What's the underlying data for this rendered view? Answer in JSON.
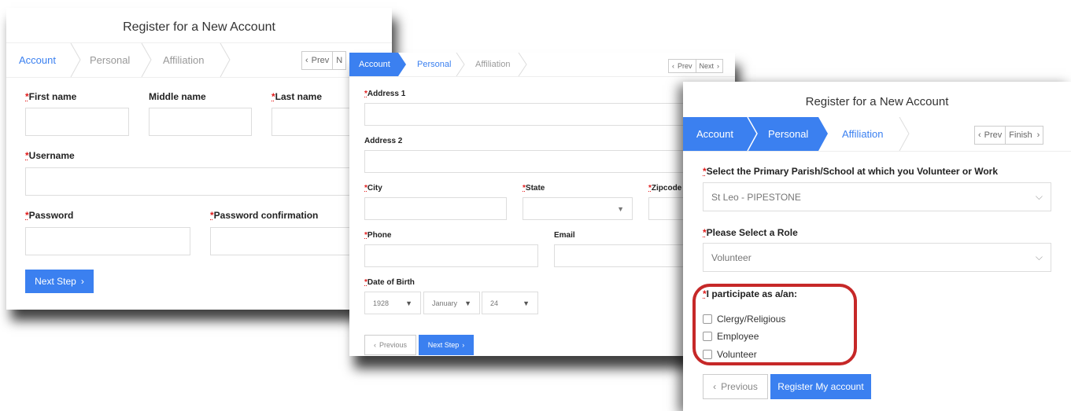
{
  "panel1": {
    "title": "Register for a New Account",
    "steps": [
      "Account",
      "Personal",
      "Affiliation"
    ],
    "nav": {
      "prev": "Prev",
      "next": "N"
    },
    "labels": {
      "first_name": "First name",
      "middle_name": "Middle name",
      "last_name": "Last name",
      "username": "Username",
      "password": "Password",
      "password_confirmation": "Password confirmation"
    },
    "next_button": "Next Step"
  },
  "panel2": {
    "steps": [
      "Account",
      "Personal",
      "Affiliation"
    ],
    "nav": {
      "prev": "Prev",
      "next": "Next"
    },
    "labels": {
      "address1": "Address 1",
      "address2": "Address 2",
      "city": "City",
      "state": "State",
      "zipcode": "Zipcode",
      "phone": "Phone",
      "email": "Email",
      "dob": "Date of Birth"
    },
    "dob": {
      "year": "1928",
      "month": "January",
      "day": "24"
    },
    "prev_button": "Previous",
    "next_button": "Next Step"
  },
  "panel3": {
    "title": "Register for a New Account",
    "steps": [
      "Account",
      "Personal",
      "Affiliation"
    ],
    "nav": {
      "prev": "Prev",
      "next": "Finish"
    },
    "parish_label": "Select the Primary Parish/School at which you Volunteer or Work",
    "parish_value": "St Leo - PIPESTONE",
    "role_label": "Please Select a Role",
    "role_value": "Volunteer",
    "participate_label": "I participate as a/an:",
    "checkboxes": [
      "Clergy/Religious",
      "Employee",
      "Volunteer"
    ],
    "prev_button": "Previous",
    "register_button": "Register My account"
  },
  "required_mark": "*",
  "colors": {
    "accent": "#3b80f0",
    "highlight": "#c62828",
    "required": "#e01b1b"
  }
}
